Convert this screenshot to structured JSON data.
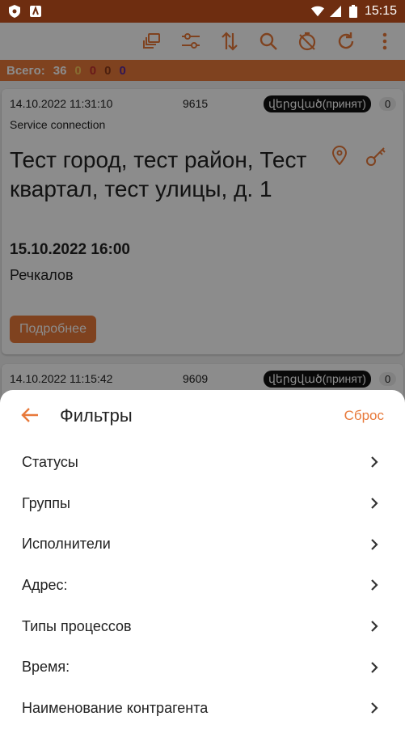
{
  "status_bar": {
    "time": "15:15"
  },
  "toolbar": {
    "icons": [
      "layers-icon",
      "sliders-icon",
      "sort-icon",
      "search-icon",
      "timer-off-icon",
      "refresh-icon",
      "more-vert-icon"
    ]
  },
  "summary": {
    "label": "Всего:",
    "total": "36",
    "counts": [
      "0",
      "0",
      "0",
      "0"
    ]
  },
  "cards": [
    {
      "datetime": "14.10.2022 11:31:10",
      "number": "9615",
      "status": "վերցված(принят)",
      "count": "0",
      "service": "Service connection",
      "address": "Тест город, тест район, Тест квартал, тест улицы, д. 1",
      "deadline": "15.10.2022 16:00",
      "executor": "Речкалов",
      "details_label": "Подробнее"
    },
    {
      "datetime": "14.10.2022 11:15:42",
      "number": "9609",
      "status": "վերցված(принят)",
      "count": "0"
    }
  ],
  "filters": {
    "title": "Фильтры",
    "reset_label": "Сброс",
    "items": [
      "Статусы",
      "Группы",
      "Исполнители",
      "Адрес:",
      "Типы процессов",
      "Время:",
      "Наименование контрагента"
    ]
  },
  "colors": {
    "accent": "#e8793a",
    "statusbar": "#6e2d10"
  }
}
